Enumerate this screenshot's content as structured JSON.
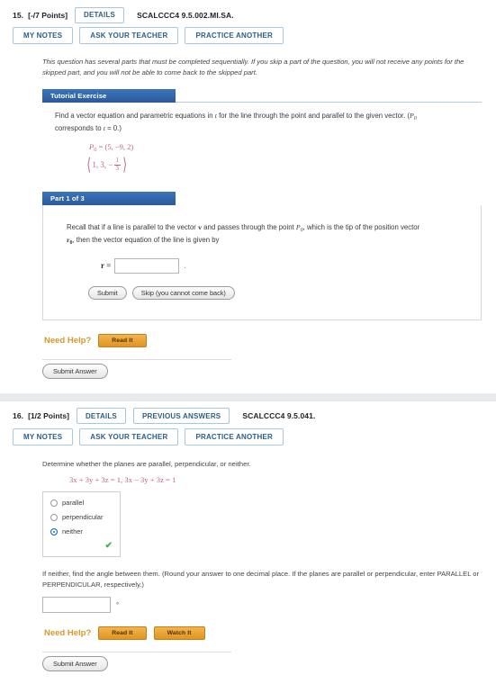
{
  "questions": [
    {
      "number": "15.",
      "points": "[-/7 Points]",
      "details_label": "DETAILS",
      "code": "SCALCCC4 9.5.002.MI.SA.",
      "actions": [
        "MY NOTES",
        "ASK YOUR TEACHER",
        "PRACTICE ANOTHER"
      ],
      "sequential_note": "This question has several parts that must be completed sequentially. If you skip a part of the question, you will not receive any points for the skipped part, and you will not be able to come back to the skipped part.",
      "tutorial": {
        "header": "Tutorial Exercise",
        "prompt_a": "Find a vector equation and parametric equations in",
        "prompt_t": "t",
        "prompt_b": "for the line through the point and parallel to the given vector. (",
        "prompt_p": "P",
        "prompt_p_sub": "0",
        "prompt_c": "corresponds to",
        "prompt_t2": "t",
        "prompt_d": "= 0.)",
        "point_label": "P",
        "point_sub": "0",
        "point_value": "= (5, −9, 2)",
        "vector_open": "⟨",
        "vector_xy": "1, 3, −",
        "vector_frac_num": "1",
        "vector_frac_den": "3",
        "vector_close": "⟩"
      },
      "part": {
        "header": "Part 1 of 3",
        "text_1": "Recall that if a line is parallel to the vector",
        "vector_v": "v",
        "text_2": "and passes through the point",
        "point_p": "P",
        "point_p_sub": "0",
        "text_3": ", which is the tip of the position vector",
        "vector_r": "r",
        "vector_r_sub": "0",
        "text_4": ", then the vector equation of the line is given by",
        "answer_label": "r =",
        "answer_value": "",
        "answer_period": ".",
        "submit_label": "Submit",
        "skip_label": "Skip (you cannot come back)"
      },
      "need_help_label": "Need Help?",
      "help_buttons": [
        "Read It"
      ],
      "submit_answer_label": "Submit Answer"
    },
    {
      "number": "16.",
      "points": "[1/2 Points]",
      "details_label": "DETAILS",
      "previous_answers_label": "PREVIOUS ANSWERS",
      "code": "SCALCCC4 9.5.041.",
      "actions": [
        "MY NOTES",
        "ASK YOUR TEACHER",
        "PRACTICE ANOTHER"
      ],
      "prompt": "Determine whether the planes are parallel, perpendicular, or neither.",
      "equations": "3x + 3y + 3z = 1,  3x − 3y + 3z = 1",
      "options": [
        "parallel",
        "perpendicular",
        "neither"
      ],
      "selected_option": "neither",
      "correct_mark": "✔",
      "tail_prompt": "If neither, find the angle between them. (Round your answer to one decimal place. If the planes are parallel or perpendicular, enter PARALLEL or PERPENDICULAR, respectively.)",
      "angle_value": "",
      "degree_symbol": "°",
      "need_help_label": "Need Help?",
      "help_buttons": [
        "Read It",
        "Watch It"
      ],
      "submit_answer_label": "Submit Answer"
    }
  ],
  "colors": {
    "header_blue": "#2a5a9c",
    "tab_text": "#2c5f86",
    "math_pink": "#b9697c",
    "help_orange": "#d8982c",
    "radio_selected": "#1268c4",
    "check_green": "#4caf50"
  }
}
